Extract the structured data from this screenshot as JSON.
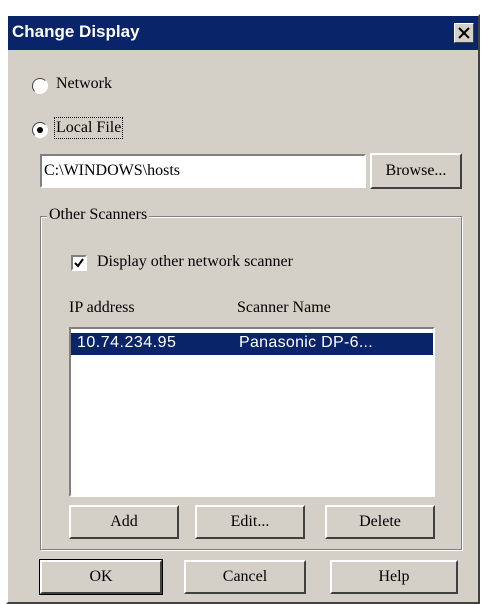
{
  "window": {
    "title": "Change Display"
  },
  "source": {
    "options": [
      {
        "label": "Network",
        "selected": false
      },
      {
        "label": "Local File",
        "selected": true
      }
    ],
    "file_path": "C:\\WINDOWS\\hosts",
    "browse_label": "Browse..."
  },
  "other_scanners": {
    "group_label": "Other Scanners",
    "display_checkbox": {
      "label": "Display other network scanner",
      "checked": true
    },
    "columns": {
      "ip": "IP address",
      "name": "Scanner Name"
    },
    "rows": [
      {
        "ip": "10.74.234.95",
        "name": "Panasonic DP-6...",
        "selected": true
      }
    ],
    "buttons": {
      "add": "Add",
      "edit": "Edit...",
      "delete": "Delete"
    }
  },
  "footer": {
    "ok": "OK",
    "cancel": "Cancel",
    "help": "Help"
  },
  "colors": {
    "titlebar": "#0a246a",
    "face": "#d4d0c8",
    "selection": "#0a246a"
  }
}
